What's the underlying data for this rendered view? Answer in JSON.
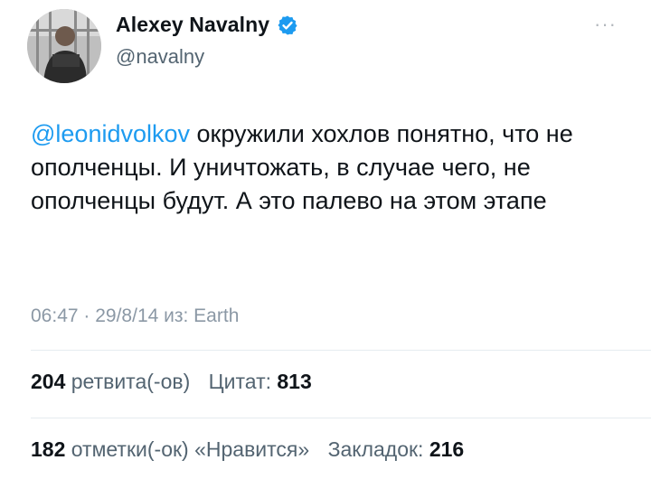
{
  "author": {
    "display_name": "Alexey Navalny",
    "handle": "@navalny",
    "verified": true,
    "avatar_icon": "profile-photo"
  },
  "menu_icon": "more-icon",
  "tweet": {
    "mention": "@leonidvolkov",
    "text": " окружили хохлов понятно, что не ополченцы. И уничтожать, в случае чего, не ополченцы будут. А это палево на этом этапе"
  },
  "meta": {
    "time": "06:47",
    "separator": " · ",
    "date": "29/8/14",
    "source": " из: Earth"
  },
  "stats": {
    "retweets_count": "204",
    "retweets_label": "ретвита(-ов)",
    "quotes_label": "Цитат:",
    "quotes_count": "813",
    "likes_count": "182",
    "likes_label": "отметки(-ок) «Нравится»",
    "bookmarks_label": "Закладок:",
    "bookmarks_count": "216"
  },
  "colors": {
    "accent": "#1d9bf0",
    "text": "#0f1419",
    "secondary": "#536471",
    "divider": "#e6ecf0"
  }
}
